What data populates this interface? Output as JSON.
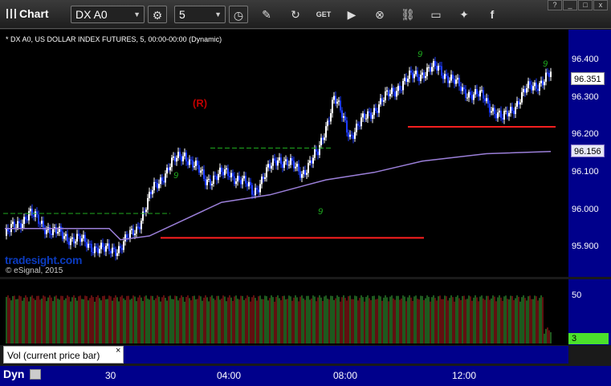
{
  "toolbar": {
    "title": "Chart",
    "symbol": "DX A0",
    "interval": "5",
    "buttons": [
      "clock-icon",
      "pencil-icon",
      "refresh-icon",
      "get-icon",
      "play-icon",
      "alert-icon",
      "link-icon",
      "comment-icon",
      "twitter-icon",
      "facebook-icon"
    ],
    "get_label": "GET"
  },
  "window_buttons": [
    "?",
    "_",
    "□",
    "x"
  ],
  "chart_header": "* DX A0, US DOLLAR INDEX FUTURES, 5, 00:00-00:00 (Dynamic)",
  "watermark": "tradesight.com",
  "copyright": "© eSignal, 2015",
  "annotation": "(R)",
  "price_axis": {
    "ticks": [
      "96.400",
      "96.300",
      "96.200",
      "96.100",
      "96.000",
      "95.900"
    ],
    "last_price": "96.351",
    "ma_value": "96.156"
  },
  "volume": {
    "tick": "50",
    "last": "3",
    "study_label": "Vol (current price bar)",
    "close_label": "×"
  },
  "time_axis": {
    "dyn": "Dyn",
    "labels": [
      "30",
      "04:00",
      "08:00",
      "12:00"
    ]
  },
  "chart_data": {
    "type": "line",
    "title": "",
    "series": [],
    "ylim": [
      95.85,
      96.43
    ],
    "levels": [
      {
        "value": 95.99,
        "style": "green-dashed"
      },
      {
        "value": 96.165,
        "style": "green-dashed"
      },
      {
        "value": 95.925,
        "style": "red"
      },
      {
        "value": 96.222,
        "style": "red"
      }
    ],
    "td_counts": [
      "9",
      "9",
      "9",
      "9",
      "5"
    ],
    "colors": {
      "up": "#ffffff",
      "down": "#1e3cff",
      "ma": "#9b7fd9",
      "vol_up": "#3bb23b",
      "vol_down": "#c02020",
      "level_red": "#ff1f1f",
      "level_green": "#1faa1f"
    }
  }
}
